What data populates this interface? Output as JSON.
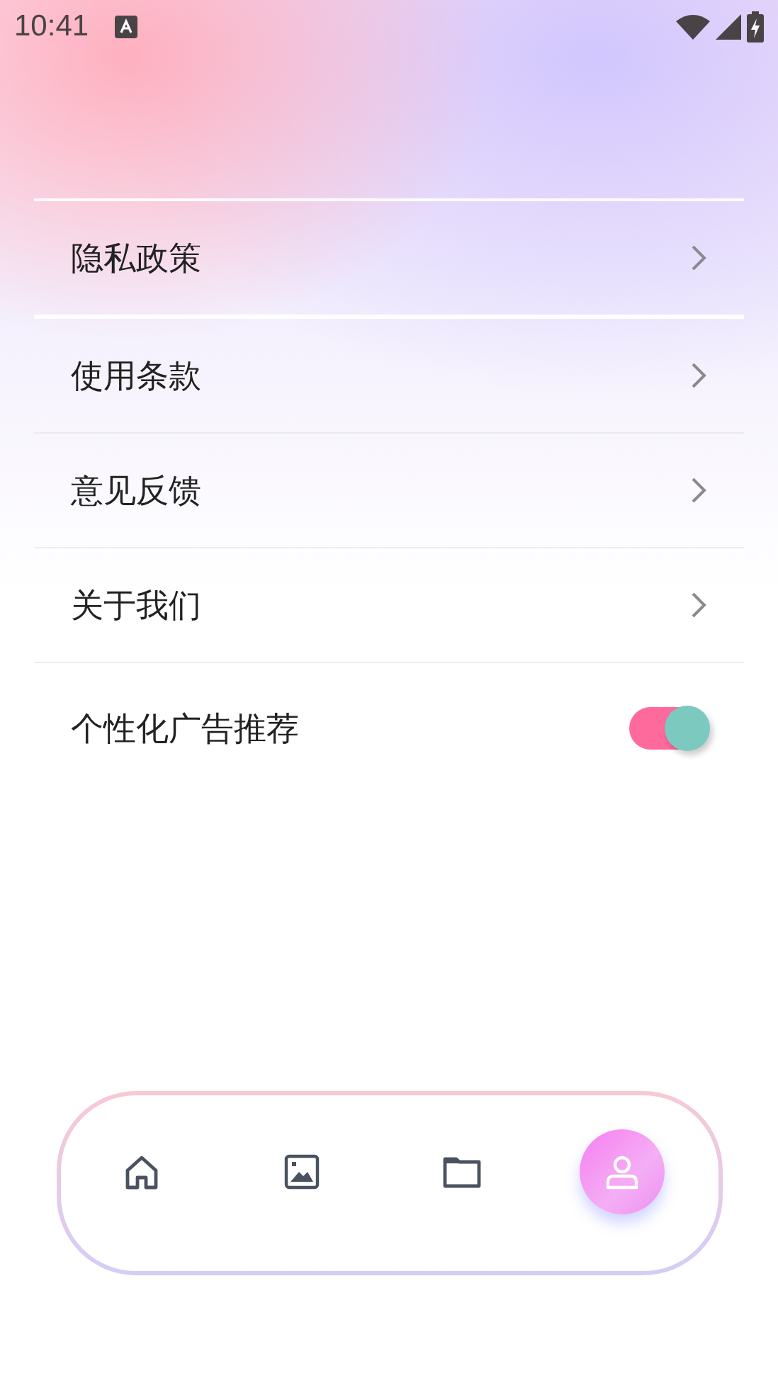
{
  "status_bar": {
    "time": "10:41"
  },
  "menu": [
    {
      "kind": "link",
      "label": "隐私政策"
    },
    {
      "kind": "link",
      "label": "使用条款"
    },
    {
      "kind": "link",
      "label": "意见反馈"
    },
    {
      "kind": "link",
      "label": "关于我们"
    },
    {
      "kind": "toggle",
      "label": "个性化广告推荐",
      "on": true
    }
  ],
  "bottom_nav": [
    {
      "kind": "home",
      "selected": false
    },
    {
      "kind": "picture",
      "selected": false
    },
    {
      "kind": "folder",
      "selected": false
    },
    {
      "kind": "profile",
      "selected": true
    }
  ]
}
